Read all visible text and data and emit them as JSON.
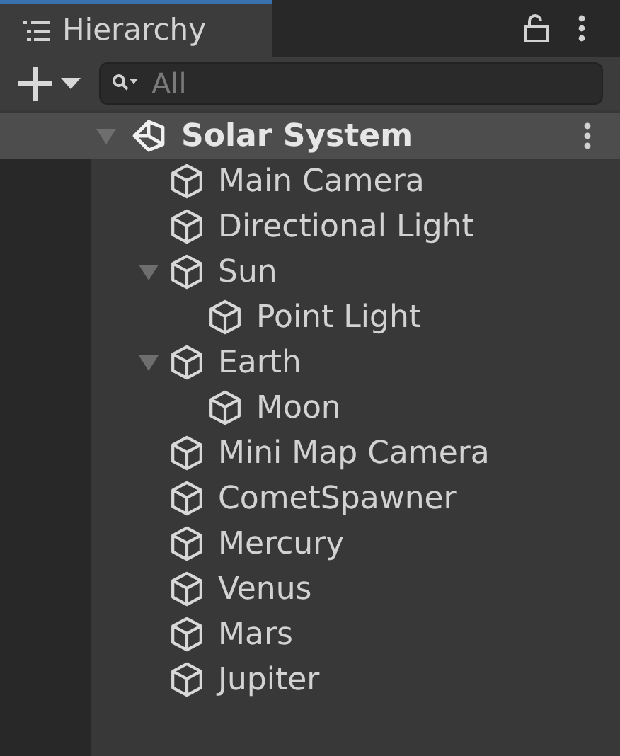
{
  "tab": {
    "title": "Hierarchy",
    "selected": true
  },
  "search": {
    "placeholder": "All"
  },
  "scene": {
    "name": "Solar System",
    "expanded": true,
    "children": [
      {
        "name": "Main Camera"
      },
      {
        "name": "Directional Light"
      },
      {
        "name": "Sun",
        "expanded": true,
        "children": [
          {
            "name": "Point Light"
          }
        ]
      },
      {
        "name": "Earth",
        "expanded": true,
        "children": [
          {
            "name": "Moon"
          }
        ]
      },
      {
        "name": "Mini Map Camera"
      },
      {
        "name": "CometSpawner"
      },
      {
        "name": "Mercury"
      },
      {
        "name": "Venus"
      },
      {
        "name": "Mars"
      },
      {
        "name": "Jupiter"
      }
    ]
  }
}
